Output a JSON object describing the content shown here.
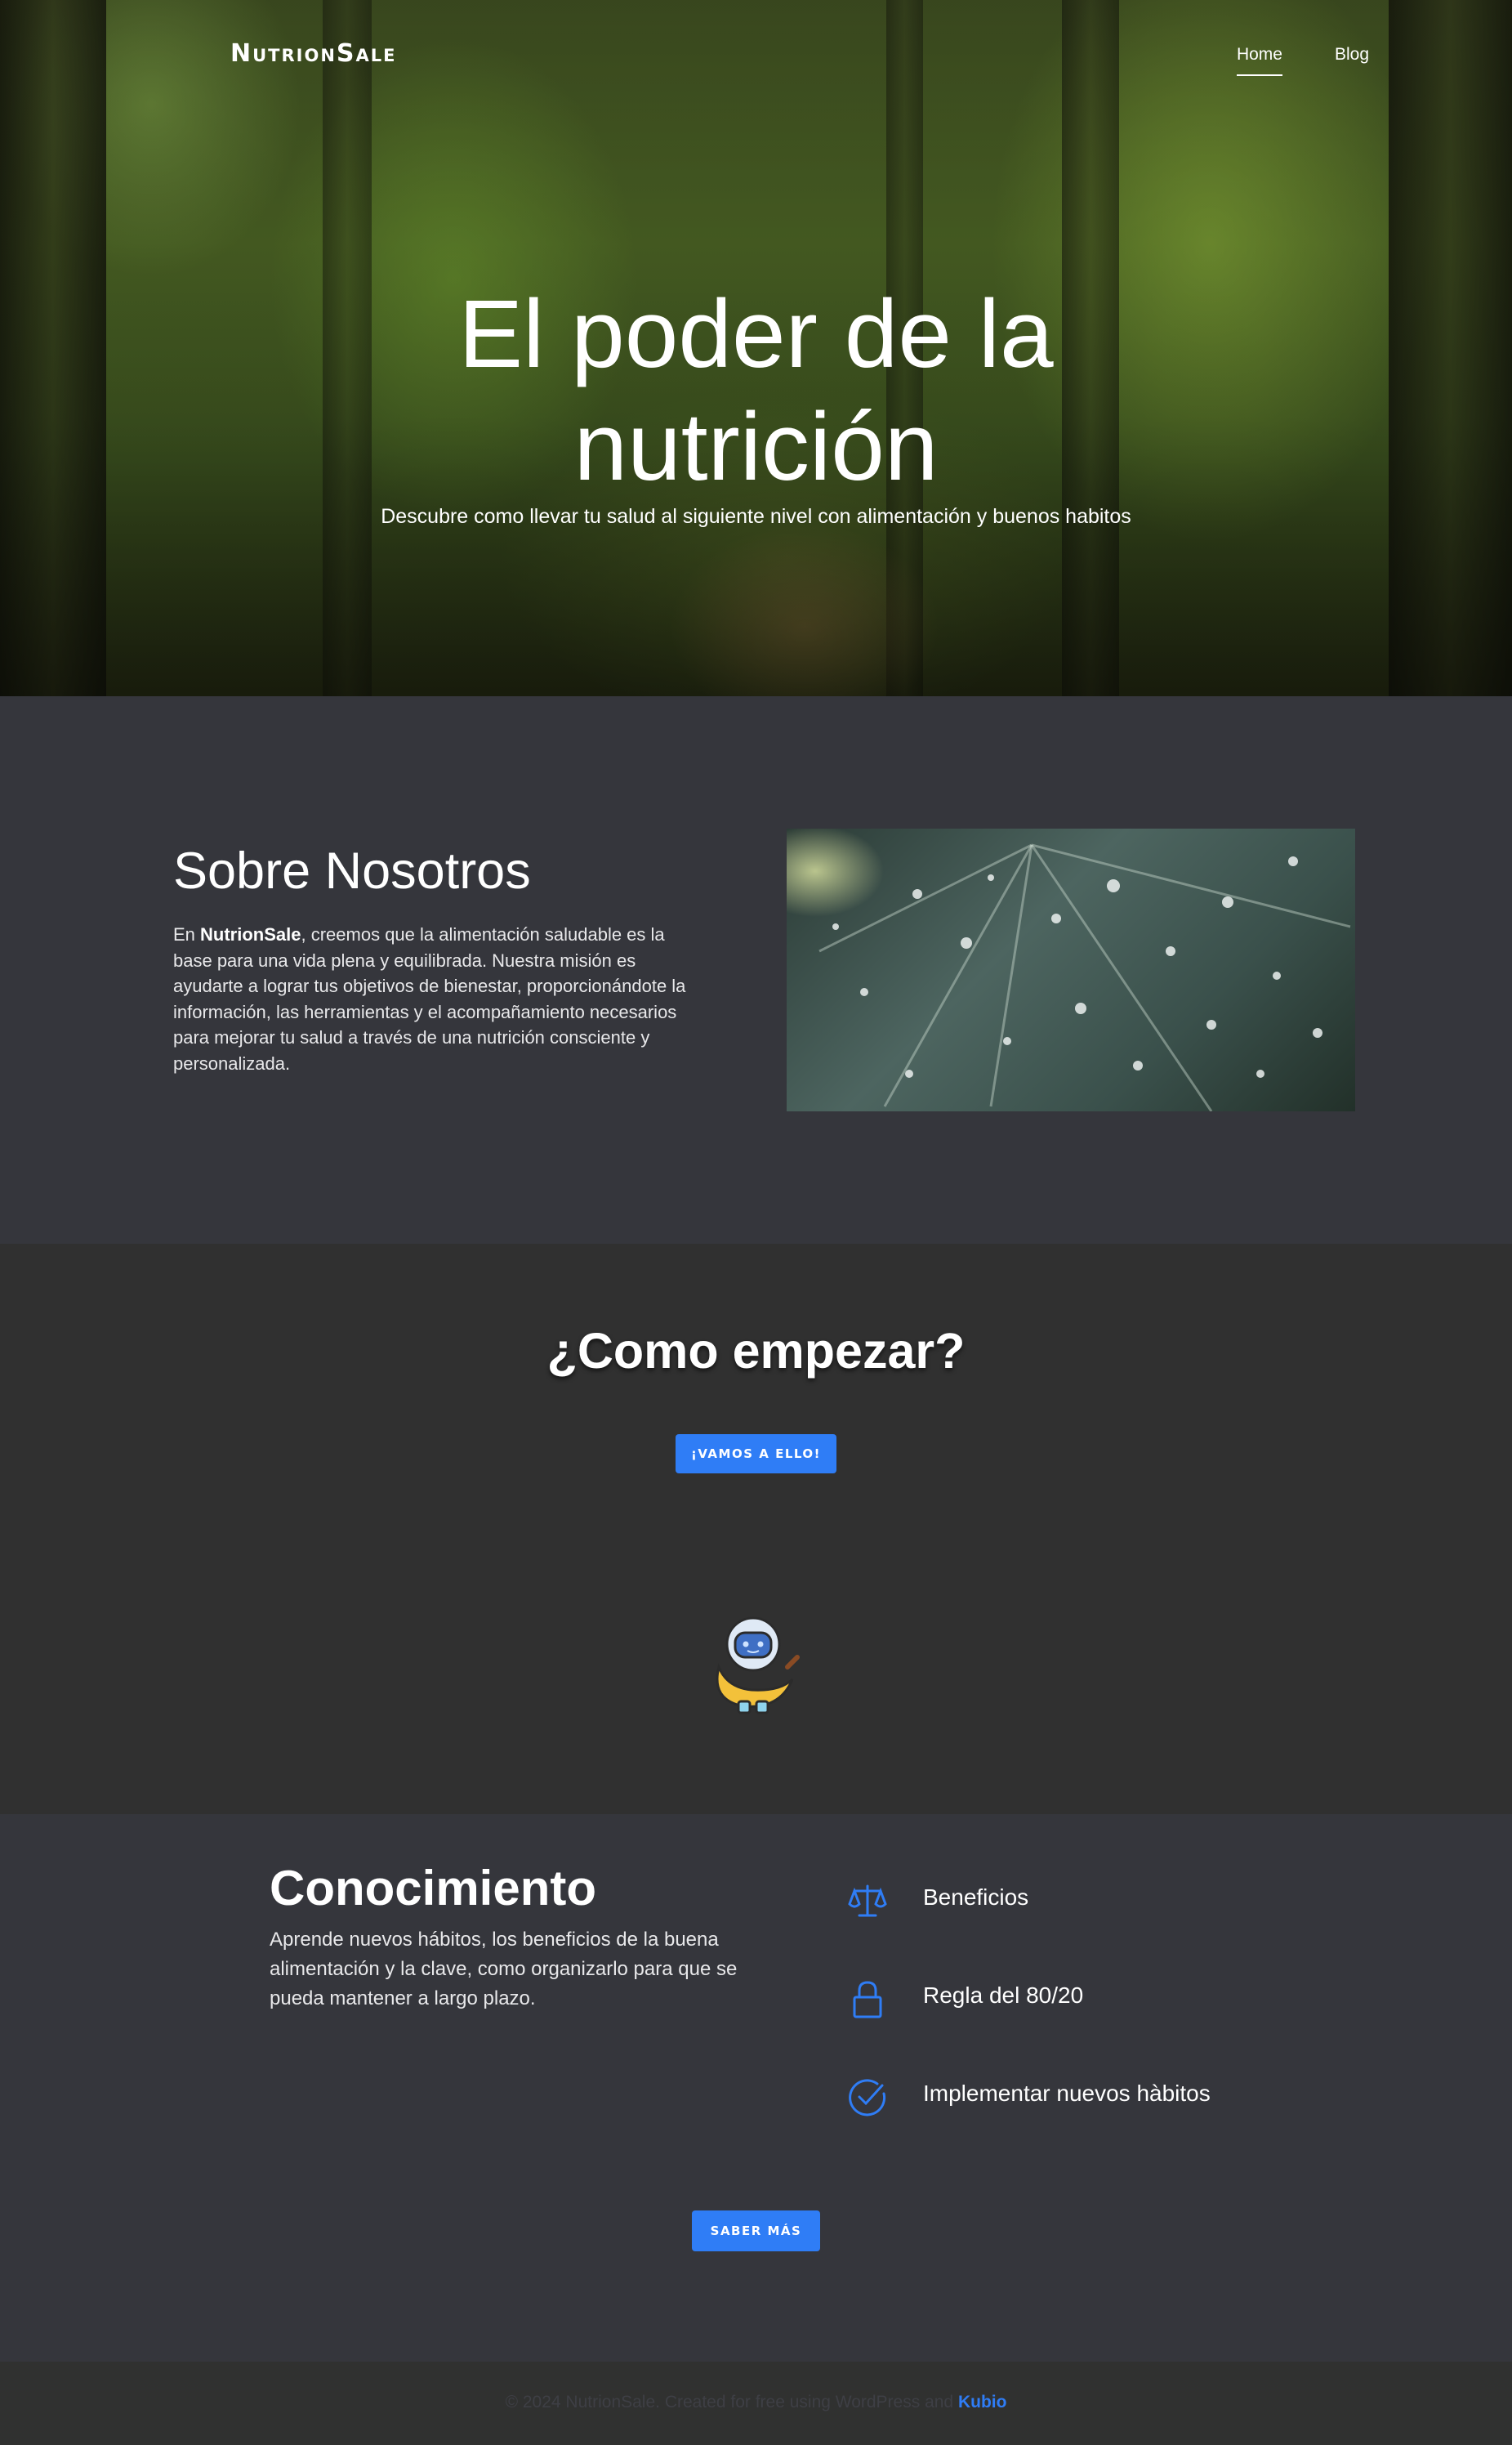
{
  "brand": {
    "logo": "NutrionSale"
  },
  "nav": {
    "items": [
      {
        "label": "Home",
        "active": true
      },
      {
        "label": "Blog",
        "active": false
      }
    ]
  },
  "hero": {
    "title_line1": "El poder de la",
    "title_line2": "nutrición",
    "subtitle": "Descubre como llevar tu salud al siguiente nivel con alimentación y buenos habitos"
  },
  "about": {
    "heading": "Sobre Nosotros",
    "text_prefix": "En ",
    "text_brand": "NutrionSale",
    "text_rest": ", creemos que la alimentación saludable es la base para una vida plena y equilibrada. Nuestra misión es ayudarte a lograr tus objetivos de bienestar, proporcionándote la información, las herramientas y el acompañamiento necesarios para mejorar tu salud a través de una nutrición consciente y personalizada.",
    "image_icon": "leaf-with-water-drops"
  },
  "start": {
    "heading": "¿Como empezar?",
    "button_label": "¡VAMOS A ELLO!",
    "mascot_icon": "astronaut-banana-mascot"
  },
  "knowledge": {
    "heading": "Conocimiento",
    "text": "Aprende nuevos hábitos, los beneficios de la buena alimentación y la clave, como organizarlo para que se pueda mantener a largo plazo.",
    "features": [
      {
        "label": "Beneficios",
        "icon": "balance-scale-icon"
      },
      {
        "label": "Regla del 80/20",
        "icon": "lock-icon"
      },
      {
        "label": "Implementar nuevos hàbitos",
        "icon": "check-circle-icon"
      }
    ],
    "button_label": "SABER MÁS"
  },
  "footer": {
    "text": "© 2024 NutrionSale. Created for free using WordPress and ",
    "link": "Kubio"
  },
  "colors": {
    "accent": "#2f7df6",
    "section_dark": "#35363c",
    "section_darker": "#303030",
    "footer_bg": "#303130"
  }
}
